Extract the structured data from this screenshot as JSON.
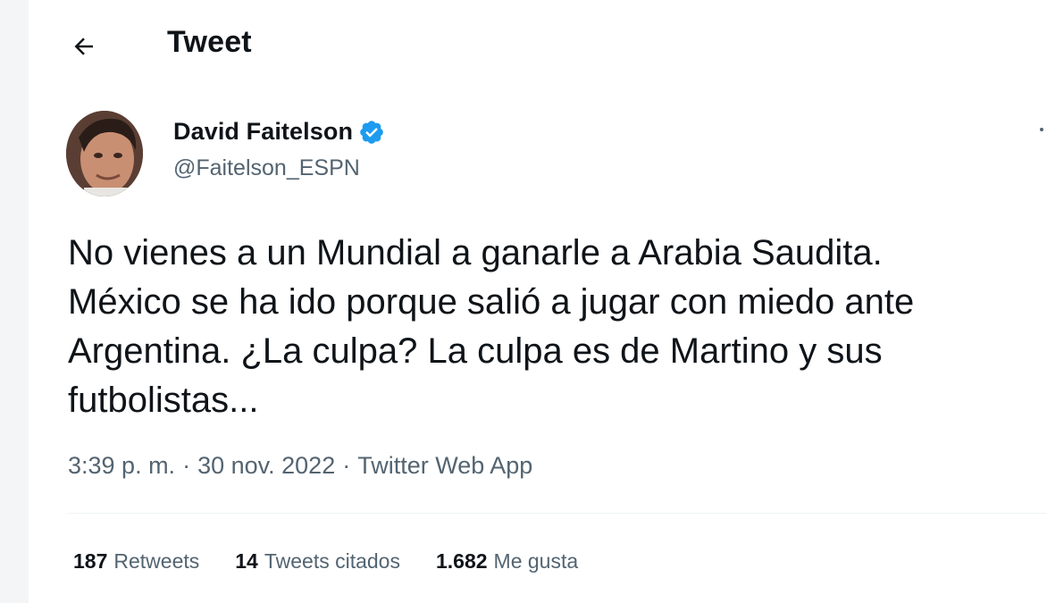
{
  "header": {
    "title": "Tweet",
    "back_icon": "arrow-left-icon"
  },
  "tweet": {
    "author": {
      "name": "David Faitelson",
      "handle": "@Faitelson_ESPN",
      "verified_icon": "verified-badge-icon",
      "verified_color": "#1d9bf0"
    },
    "text_lines": [
      "No vienes a un Mundial a ganarle a Arabia Saudita.",
      "México se ha ido porque salió a jugar con miedo ante",
      "Argentina. ¿La culpa? La culpa es de Martino y sus",
      "futbolistas..."
    ],
    "time": "3:39 p. m.",
    "date": "30 nov. 2022",
    "source": "Twitter Web App",
    "separator": "·"
  },
  "stats": {
    "retweets": {
      "count": "187",
      "label": "Retweets"
    },
    "quotes": {
      "count": "14",
      "label": "Tweets citados"
    },
    "likes": {
      "count": "1.682",
      "label": "Me gusta"
    }
  },
  "colors": {
    "text_primary": "#0f1419",
    "text_secondary": "#536471",
    "accent": "#1d9bf0"
  }
}
